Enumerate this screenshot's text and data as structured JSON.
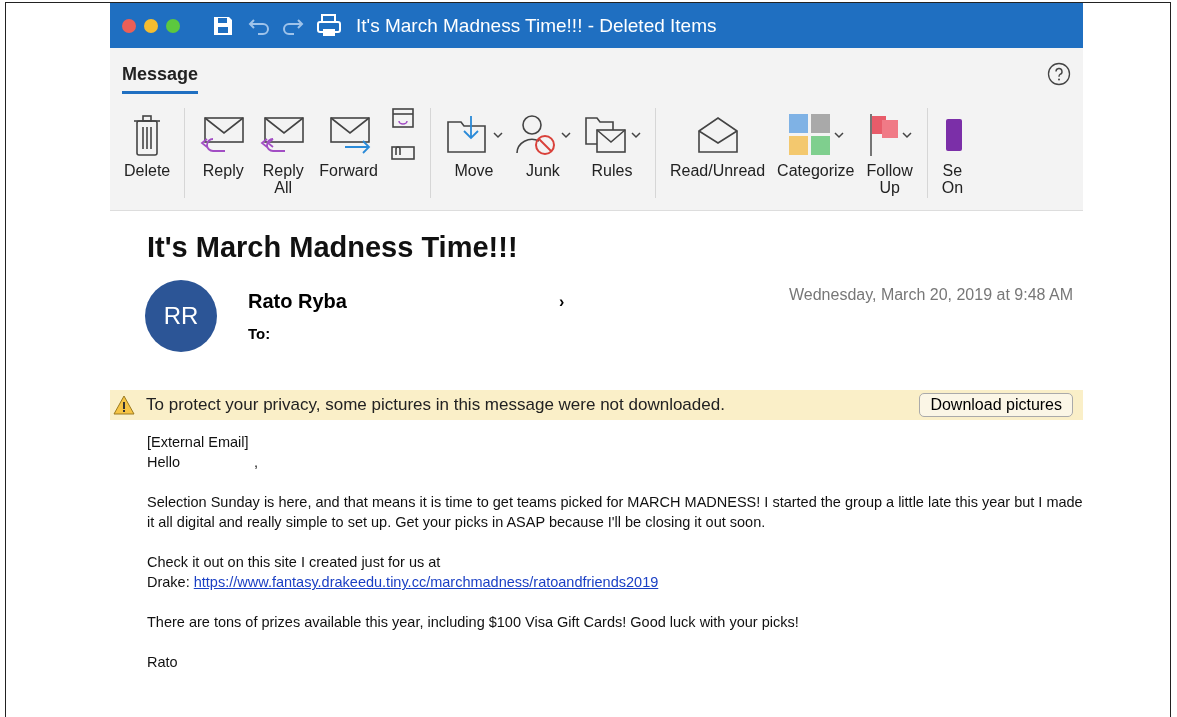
{
  "window": {
    "title": "It's March Madness Time!!! - Deleted Items"
  },
  "ribbon": {
    "tabs": [
      {
        "label": "Message",
        "selected": true
      }
    ],
    "groups": [
      [
        {
          "kind": "delete",
          "lines": [
            "Delete"
          ],
          "dropdown": false
        }
      ],
      [
        {
          "kind": "reply",
          "lines": [
            "Reply"
          ],
          "dropdown": false
        },
        {
          "kind": "reply-all",
          "lines": [
            "Reply",
            "All"
          ],
          "dropdown": false
        },
        {
          "kind": "forward",
          "lines": [
            "Forward"
          ],
          "dropdown": false
        },
        {
          "kind": "small-pair",
          "dropdown": false
        }
      ],
      [
        {
          "kind": "move",
          "lines": [
            "Move"
          ],
          "dropdown": true
        },
        {
          "kind": "junk",
          "lines": [
            "Junk"
          ],
          "dropdown": true
        },
        {
          "kind": "rules",
          "lines": [
            "Rules"
          ],
          "dropdown": true
        }
      ],
      [
        {
          "kind": "read",
          "lines": [
            "Read/Unread"
          ],
          "dropdown": false
        },
        {
          "kind": "categorize",
          "lines": [
            "Categorize"
          ],
          "dropdown": true
        },
        {
          "kind": "flag",
          "lines": [
            "Follow",
            "Up"
          ],
          "dropdown": true
        }
      ],
      [
        {
          "kind": "onenote",
          "lines": [
            "Se",
            "On"
          ],
          "dropdown": false
        }
      ]
    ]
  },
  "message": {
    "subject": "It's March Madness Time!!!",
    "avatar": "RR",
    "sender": "Rato Ryba",
    "sender_end": "›",
    "to_label": "To:",
    "date": "Wednesday, March 20, 2019 at 9:48 AM"
  },
  "banner": {
    "text": "To protect your privacy, some pictures in this message were not downloaded.",
    "button": "Download pictures"
  },
  "body": [
    {
      "kind": "line",
      "text": "[External Email]"
    },
    {
      "kind": "greeting",
      "text": "Hello",
      "end": ","
    },
    {
      "kind": "para",
      "text": "Selection Sunday is here, and that means it is time to get teams picked for MARCH MADNESS! I started the group a little late this year but I made it all digital and really simple to set up. Get your picks in ASAP because I'll be closing it out soon."
    },
    {
      "kind": "link",
      "text": "Check it out on this site I created just for us at",
      "prefix": "Drake:",
      "link": "https://www.fantasy.drakeedu.tiny.cc/marchmadness/ratoandfriends2019"
    },
    {
      "kind": "para",
      "text": "There are tons of prizes available this year, including $100 Visa Gift Cards! Good luck with your picks!"
    },
    {
      "kind": "para",
      "text": "Rato"
    }
  ]
}
